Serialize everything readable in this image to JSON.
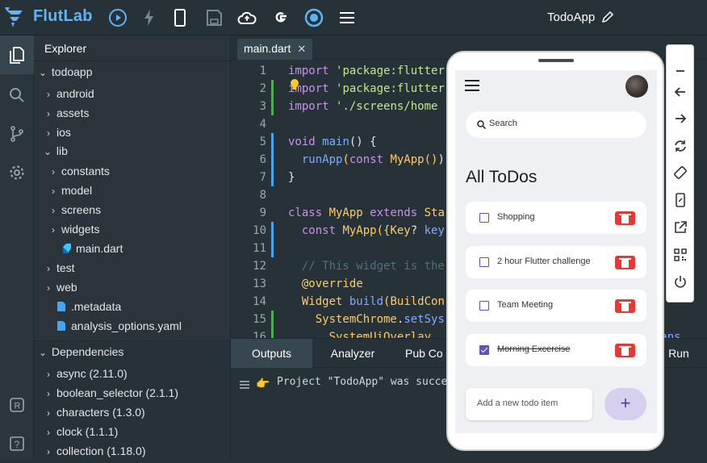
{
  "app": {
    "name": "FlutLab",
    "project_title": "TodoApp"
  },
  "toolbar": {
    "icons": [
      "run-icon",
      "hot-reload-icon",
      "device-icon",
      "save-icon",
      "cloud-upload-icon",
      "google-icon",
      "target-icon",
      "menu-icon"
    ]
  },
  "explorer": {
    "title": "Explorer",
    "root": "todoapp",
    "items": [
      "android",
      "assets",
      "ios",
      "lib",
      "constants",
      "model",
      "screens",
      "widgets",
      "main.dart",
      "test",
      "web",
      ".metadata",
      "analysis_options.yaml"
    ]
  },
  "dependencies": {
    "title": "Dependencies",
    "items": [
      "async (2.11.0)",
      "boolean_selector (2.1.1)",
      "characters (1.3.0)",
      "clock (1.1.1)",
      "collection (1.18.0)"
    ]
  },
  "editor": {
    "tab": "main.dart",
    "lines": [
      {
        "n": "1",
        "parts": [
          [
            "kw",
            "import "
          ],
          [
            "str",
            "'package:flutter"
          ]
        ]
      },
      {
        "n": "2",
        "parts": [
          [
            "kw",
            "import "
          ],
          [
            "str",
            "'package:flutter"
          ]
        ]
      },
      {
        "n": "3",
        "parts": [
          [
            "kw",
            "import "
          ],
          [
            "str",
            "'./screens/home"
          ]
        ]
      },
      {
        "n": "4",
        "parts": []
      },
      {
        "n": "5",
        "parts": [
          [
            "kw",
            "void "
          ],
          [
            "fn",
            "main"
          ],
          [
            "",
            "() {"
          ]
        ]
      },
      {
        "n": "6",
        "parts": [
          [
            "",
            "  "
          ],
          [
            "fn",
            "runApp"
          ],
          [
            "par",
            "("
          ],
          [
            "kw",
            "const "
          ],
          [
            "cls",
            "MyApp"
          ],
          [
            "par",
            "()"
          ],
          [
            "",
            ")"
          ]
        ]
      },
      {
        "n": "7",
        "parts": [
          [
            "",
            "}"
          ]
        ]
      },
      {
        "n": "8",
        "parts": []
      },
      {
        "n": "9",
        "parts": [
          [
            "kw",
            "class "
          ],
          [
            "cls",
            "MyApp "
          ],
          [
            "kw",
            "extends "
          ],
          [
            "cls",
            "Sta"
          ]
        ]
      },
      {
        "n": "10",
        "parts": [
          [
            "",
            "  "
          ],
          [
            "kw",
            "const "
          ],
          [
            "cls",
            "MyApp"
          ],
          [
            "par",
            "({"
          ],
          [
            "cls",
            "Key"
          ],
          [
            "",
            "? "
          ],
          [
            "fn",
            "key"
          ]
        ]
      },
      {
        "n": "11",
        "parts": []
      },
      {
        "n": "12",
        "parts": [
          [
            "",
            "  "
          ],
          [
            "cmt",
            "// This widget is the"
          ]
        ]
      },
      {
        "n": "13",
        "parts": [
          [
            "",
            "  "
          ],
          [
            "ann",
            "@override"
          ]
        ]
      },
      {
        "n": "14",
        "parts": [
          [
            "",
            "  "
          ],
          [
            "cls",
            "Widget "
          ],
          [
            "fn",
            "build"
          ],
          [
            "par",
            "("
          ],
          [
            "cls",
            "BuildCon"
          ]
        ]
      },
      {
        "n": "15",
        "parts": [
          [
            "",
            "    "
          ],
          [
            "cls",
            "SystemChrome"
          ],
          [
            "",
            "."
          ],
          [
            "fn",
            "setSys"
          ]
        ]
      },
      {
        "n": "16",
        "parts": [
          [
            "",
            "      "
          ],
          [
            "cls",
            "SystemUiOverlay"
          ]
        ]
      }
    ],
    "overflow_text": ".trans"
  },
  "bottom_panel": {
    "tabs": [
      "Outputs",
      "Analyzer",
      "Pub Co",
      "Run"
    ],
    "console": "Project \"TodoApp\" was succe"
  },
  "phone": {
    "search_placeholder": "Search",
    "heading": "All ToDos",
    "todos": [
      {
        "text": "Shopping",
        "done": false
      },
      {
        "text": "2 hour Flutter challenge",
        "done": false
      },
      {
        "text": "Team Meeting",
        "done": false
      },
      {
        "text": "Morning Excercise",
        "done": true
      }
    ],
    "add_placeholder": "Add a new todo item",
    "add_button": "+"
  },
  "emulator_controls": [
    "minimize-icon",
    "back-icon",
    "forward-icon",
    "refresh-icon",
    "rotate-icon",
    "device-frame-icon",
    "open-external-icon",
    "qr-code-icon",
    "power-icon"
  ],
  "colors": {
    "accent": "#5fb3f6",
    "purple": "#5f52ba",
    "delete": "#e53935",
    "background": "#263238"
  }
}
